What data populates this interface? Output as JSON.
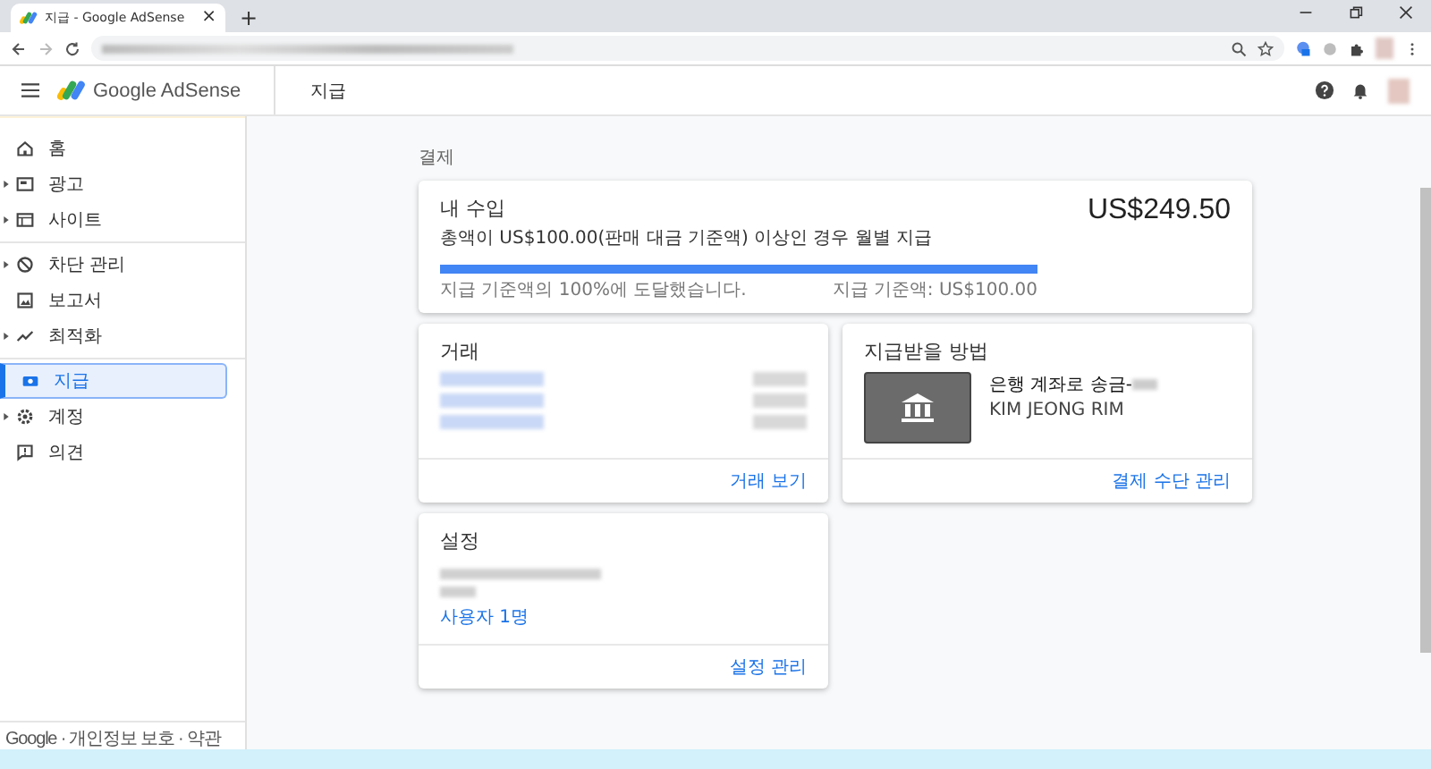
{
  "browser": {
    "tab_title": "지급 - Google AdSense",
    "tab_close": "×",
    "new_tab": "+"
  },
  "app_bar": {
    "logo_text": "Google AdSense",
    "page_title": "지급"
  },
  "sidebar": {
    "groups": [
      [
        {
          "label": "홈",
          "expandable": false,
          "selected": false
        },
        {
          "label": "광고",
          "expandable": true,
          "selected": false
        },
        {
          "label": "사이트",
          "expandable": true,
          "selected": false
        }
      ],
      [
        {
          "label": "차단 관리",
          "expandable": true,
          "selected": false
        },
        {
          "label": "보고서",
          "expandable": false,
          "selected": false
        },
        {
          "label": "최적화",
          "expandable": true,
          "selected": false
        }
      ],
      [
        {
          "label": "지급",
          "expandable": false,
          "selected": true
        },
        {
          "label": "계정",
          "expandable": true,
          "selected": false
        },
        {
          "label": "의견",
          "expandable": false,
          "selected": false
        }
      ]
    ],
    "footer": "Google · 개인정보 보호 · 약관"
  },
  "breadcrumb": "결제",
  "earnings": {
    "title": "내 수입",
    "subtitle": "총액이 US$100.00(판매 대금 기준액) 이상인 경우 월별 지급",
    "amount": "US$249.50",
    "level": 1,
    "progress_left": "지급 기준액의 100%에 도달했습니다.",
    "progress_right": "지급 기준액: US$100.00"
  },
  "transactions": {
    "title": "거래",
    "link": "거래 보기"
  },
  "payment_method": {
    "title": "지급받을 방법",
    "account": "은행 계좌로 송금-",
    "holder": "KIM JEONG RIM",
    "link": "결제 수단 관리"
  },
  "settings": {
    "title": "설정",
    "users": "사용자 1명",
    "link": "설정 관리"
  }
}
